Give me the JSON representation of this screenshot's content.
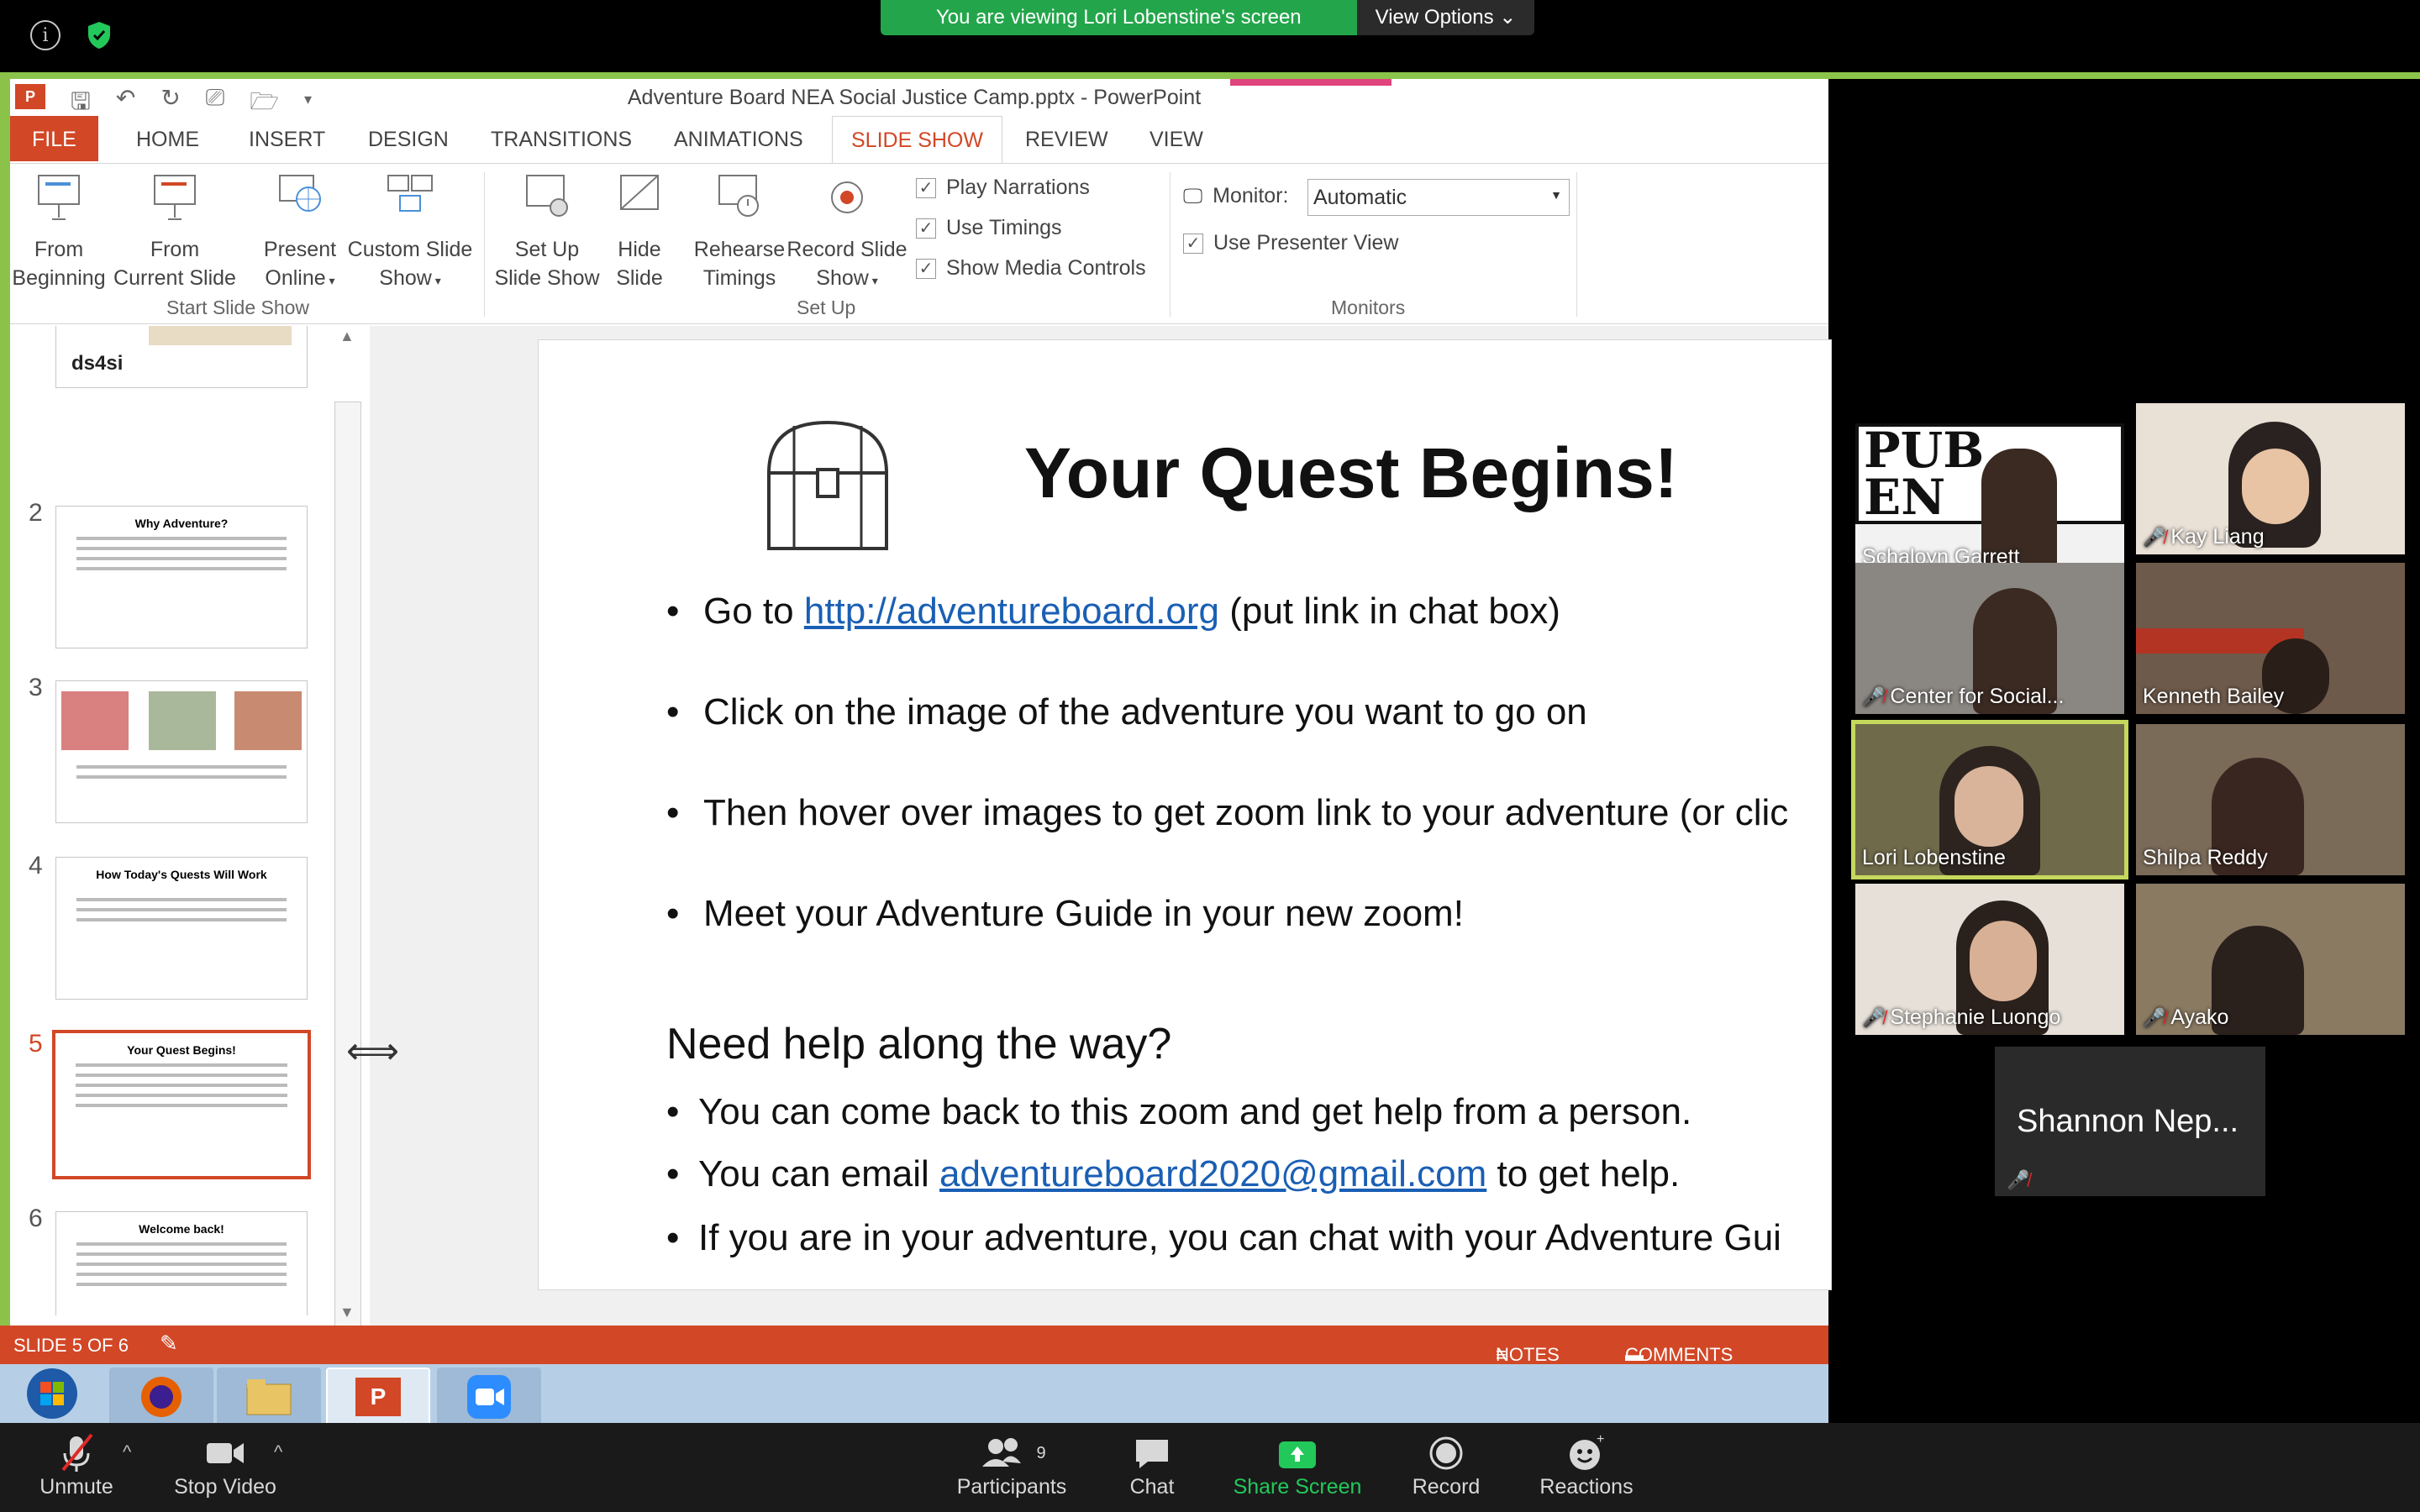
{
  "zoom": {
    "share_banner": "You are viewing Lori Lobenstine's screen",
    "view_options": "View Options",
    "bottom": {
      "unmute": "Unmute",
      "stop_video": "Stop Video",
      "participants": "Participants",
      "participants_count": "9",
      "chat": "Chat",
      "share_screen": "Share Screen",
      "record": "Record",
      "reactions": "Reactions"
    },
    "participants": [
      {
        "name": "Schaloyn Garrett",
        "muted": false
      },
      {
        "name": "Kay Liang",
        "muted": true
      },
      {
        "name": "Center for Social...",
        "muted": true
      },
      {
        "name": "Kenneth Bailey",
        "muted": false
      },
      {
        "name": "Lori Lobenstine",
        "muted": false
      },
      {
        "name": "Shilpa Reddy",
        "muted": false
      },
      {
        "name": "Stephanie Luongo",
        "muted": true
      },
      {
        "name": "Ayako",
        "muted": true
      }
    ],
    "name_tile": "Shannon Nep..."
  },
  "ppt": {
    "window_title": "Adventure Board NEA Social Justice Camp.pptx - PowerPoint",
    "tabs": [
      "FILE",
      "HOME",
      "INSERT",
      "DESIGN",
      "TRANSITIONS",
      "ANIMATIONS",
      "SLIDE SHOW",
      "REVIEW",
      "VIEW"
    ],
    "active_tab": "SLIDE SHOW",
    "ribbon": {
      "from_beginning_1": "From",
      "from_beginning_2": "Beginning",
      "from_current_1": "From",
      "from_current_2": "Current Slide",
      "present_online_1": "Present",
      "present_online_2": "Online",
      "custom_show_1": "Custom Slide",
      "custom_show_2": "Show",
      "group_start": "Start Slide Show",
      "setup_show_1": "Set Up",
      "setup_show_2": "Slide Show",
      "hide_slide_1": "Hide",
      "hide_slide_2": "Slide",
      "rehearse_1": "Rehearse",
      "rehearse_2": "Timings",
      "record_1": "Record Slide",
      "record_2": "Show",
      "play_narrations": "Play Narrations",
      "use_timings": "Use Timings",
      "show_media": "Show Media Controls",
      "group_setup": "Set Up",
      "monitor_label": "Monitor:",
      "monitor_value": "Automatic",
      "presenter_view": "Use Presenter View",
      "group_monitors": "Monitors"
    },
    "thumbnails": [
      {
        "num": "2",
        "title": "Why Adventure?"
      },
      {
        "num": "3",
        "title": ""
      },
      {
        "num": "4",
        "title": "How Today's Quests Will Work"
      },
      {
        "num": "5",
        "title": "Your Quest Begins!"
      },
      {
        "num": "6",
        "title": "Welcome back!"
      }
    ],
    "thumb1_text": "ds4si",
    "slide": {
      "title": "Your Quest Begins!",
      "b1_pre": "Go to ",
      "b1_link": "http://adventureboard.org",
      "b1_post": "  (put link in chat box)",
      "b2": "Click on the image of the adventure you want to go on",
      "b3": "Then hover over images to get zoom link to your adventure (or clic",
      "b4": "Meet your Adventure Guide in your new zoom!",
      "help_head": "Need help along the way?",
      "h1": "You can come back to this zoom and get help from a person.",
      "h2_pre": "You can email ",
      "h2_link": "adventureboard2020@gmail.com",
      "h2_post": " to get help.",
      "h3": "If you are in your adventure, you can chat with your Adventure Gui"
    },
    "status": {
      "slide_of": "SLIDE 5 OF 6",
      "notes": "NOTES",
      "comments": "COMMENTS"
    }
  },
  "colors": {
    "accent_ppt": "#d24726",
    "zoom_green": "#23a64b",
    "speaker_outline": "#c6d85c"
  }
}
